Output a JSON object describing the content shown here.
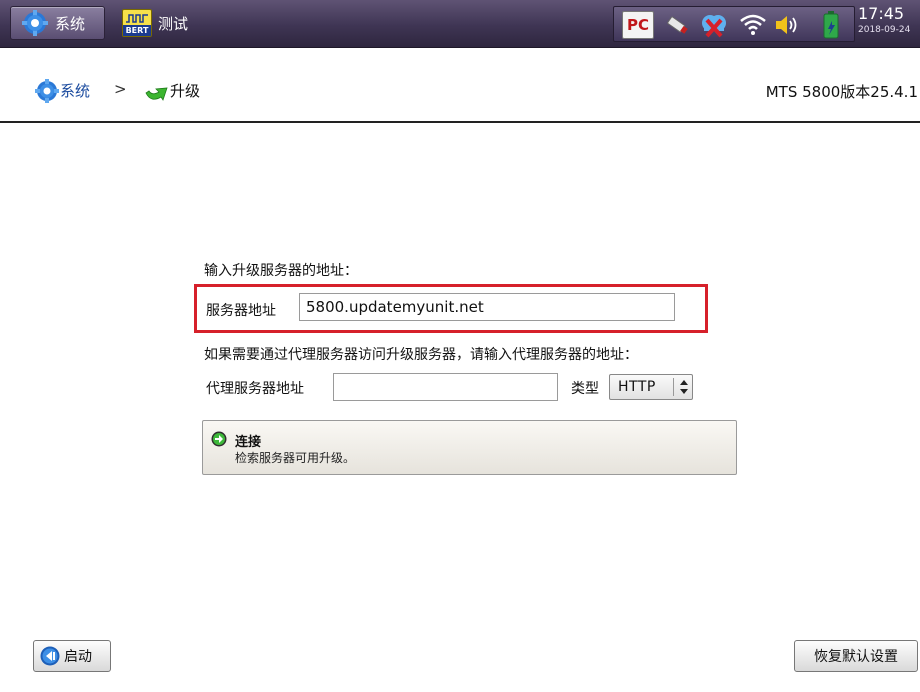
{
  "topbar": {
    "system_label": "系统",
    "test_label": "测试",
    "test_icon_tag": "BERT",
    "tray": {
      "pc_icon_text": "PC",
      "icons": [
        "pc-icon",
        "usb-stick-icon",
        "network-disconnected-icon",
        "wifi-icon",
        "speaker-icon",
        "battery-icon"
      ]
    },
    "time": "17:45",
    "date": "2018-09-24"
  },
  "breadcrumb": {
    "system": "系统",
    "separator": ">",
    "current": "升级"
  },
  "version": "MTS 5800版本25.4.1",
  "form": {
    "server_prompt": "输入升级服务器的地址：",
    "server_label": "服务器地址",
    "server_value": "5800.updatemyunit.net",
    "proxy_prompt": "如果需要通过代理服务器访问升级服务器，请输入代理服务器的地址：",
    "proxy_label": "代理服务器地址",
    "proxy_value": "",
    "type_label": "类型",
    "type_value": "HTTP"
  },
  "connect": {
    "title": "连接",
    "description": "检索服务器可用升级。"
  },
  "footer": {
    "start_label": "启动",
    "reset_label": "恢复默认设置"
  },
  "colors": {
    "topbar": "#3f3554",
    "highlight_border": "#d6202a",
    "breadcrumb_link": "#1a4a9e"
  }
}
